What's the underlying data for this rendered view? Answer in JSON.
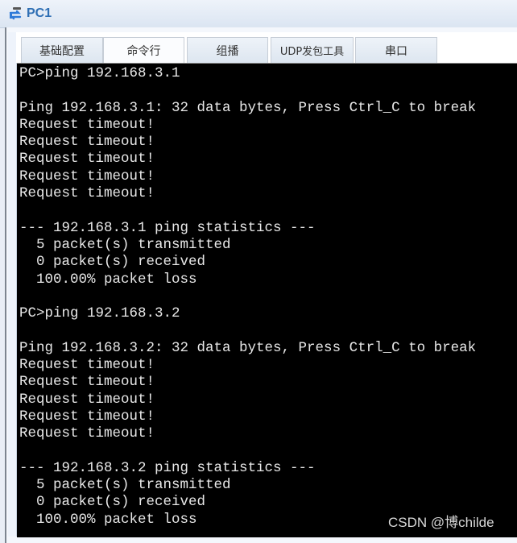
{
  "window": {
    "title": "PC1",
    "icon": "network-device-icon"
  },
  "tabs": [
    {
      "label": "基础配置",
      "active": false
    },
    {
      "label": "命令行",
      "active": true
    },
    {
      "label": "组播",
      "active": false
    },
    {
      "label": "UDP发包工具",
      "active": false
    },
    {
      "label": "串口",
      "active": false
    }
  ],
  "terminal": {
    "lines": [
      "PC>ping 192.168.3.1",
      "",
      "Ping 192.168.3.1: 32 data bytes, Press Ctrl_C to break",
      "Request timeout!",
      "Request timeout!",
      "Request timeout!",
      "Request timeout!",
      "Request timeout!",
      "",
      "--- 192.168.3.1 ping statistics ---",
      "  5 packet(s) transmitted",
      "  0 packet(s) received",
      "  100.00% packet loss",
      "",
      "PC>ping 192.168.3.2",
      "",
      "Ping 192.168.3.2: 32 data bytes, Press Ctrl_C to break",
      "Request timeout!",
      "Request timeout!",
      "Request timeout!",
      "Request timeout!",
      "Request timeout!",
      "",
      "--- 192.168.3.2 ping statistics ---",
      "  5 packet(s) transmitted",
      "  0 packet(s) received",
      "  100.00% packet loss"
    ]
  },
  "watermark": "CSDN @博childe"
}
